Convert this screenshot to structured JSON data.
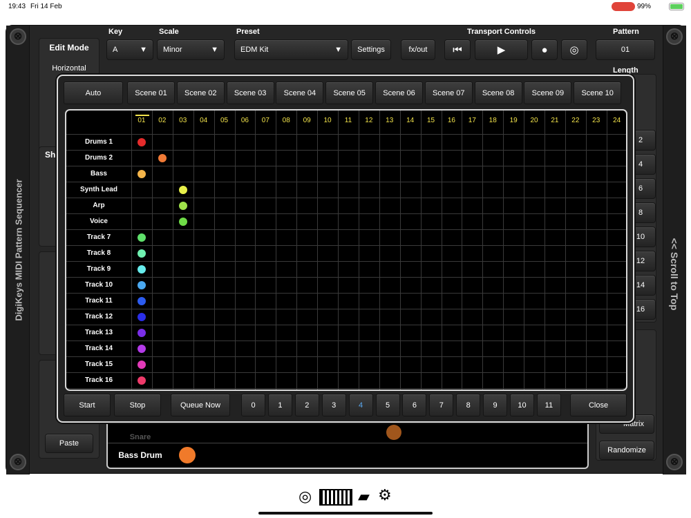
{
  "status": {
    "time": "19:43",
    "date": "Fri 14 Feb",
    "battery": "99%"
  },
  "app": {
    "title": "DigiKeys MIDI Pattern Sequencer",
    "scroll_to_top": "<< Scroll to Top"
  },
  "top": {
    "key_label": "Key",
    "key_value": "A",
    "scale_label": "Scale",
    "scale_value": "Minor",
    "preset_label": "Preset",
    "preset_value": "EDM Kit",
    "settings": "Settings",
    "fxout": "fx/out",
    "transport_label": "Transport Controls",
    "pattern_label": "Pattern",
    "pattern_value": "01",
    "length_label": "Length"
  },
  "left_panel": {
    "edit_mode_label": "Edit Mode",
    "edit_mode_value": "Horizontal",
    "paste": "Paste",
    "sho": "Sho"
  },
  "right_panel": {
    "numbers": [
      "2",
      "4",
      "6",
      "8",
      "10",
      "12",
      "14",
      "16"
    ],
    "matrix": "Matrix",
    "randomize": "Randomize"
  },
  "background_rows": {
    "snare": "Snare",
    "bass_drum": "Bass Drum"
  },
  "modal": {
    "auto": "Auto",
    "scenes": [
      "Scene 01",
      "Scene 02",
      "Scene 03",
      "Scene 04",
      "Scene 05",
      "Scene 06",
      "Scene 07",
      "Scene 08",
      "Scene 09",
      "Scene 10"
    ],
    "columns": [
      "01",
      "02",
      "03",
      "04",
      "05",
      "06",
      "07",
      "08",
      "09",
      "10",
      "11",
      "12",
      "13",
      "14",
      "15",
      "16",
      "17",
      "18",
      "19",
      "20",
      "21",
      "22",
      "23",
      "24"
    ],
    "tracks": [
      {
        "name": "Drums 1",
        "dot_col": 0,
        "color": "#e52b2b"
      },
      {
        "name": "Drums 2",
        "dot_col": 1,
        "color": "#f07a36"
      },
      {
        "name": "Bass",
        "dot_col": 0,
        "color": "#f4b54a"
      },
      {
        "name": "Synth Lead",
        "dot_col": 2,
        "color": "#e8f04a"
      },
      {
        "name": "Arp",
        "dot_col": 2,
        "color": "#9fe24a"
      },
      {
        "name": "Voice",
        "dot_col": 2,
        "color": "#6fdc47"
      },
      {
        "name": "Track 7",
        "dot_col": 0,
        "color": "#5fe06b"
      },
      {
        "name": "Track 8",
        "dot_col": 0,
        "color": "#6ff0b0"
      },
      {
        "name": "Track 9",
        "dot_col": 0,
        "color": "#67ecec"
      },
      {
        "name": "Track 10",
        "dot_col": 0,
        "color": "#4aa8f0"
      },
      {
        "name": "Track 11",
        "dot_col": 0,
        "color": "#2c5cf0"
      },
      {
        "name": "Track 12",
        "dot_col": 0,
        "color": "#2a2ee8"
      },
      {
        "name": "Track 13",
        "dot_col": 0,
        "color": "#7a2ee8"
      },
      {
        "name": "Track 14",
        "dot_col": 0,
        "color": "#b43ae8"
      },
      {
        "name": "Track 15",
        "dot_col": 0,
        "color": "#e23ab8"
      },
      {
        "name": "Track 16",
        "dot_col": 0,
        "color": "#ee3a6a"
      }
    ],
    "start": "Start",
    "stop": "Stop",
    "queue_now": "Queue Now",
    "queue_numbers": [
      "0",
      "1",
      "2",
      "3",
      "4",
      "5",
      "6",
      "7",
      "8",
      "9",
      "10",
      "11"
    ],
    "queue_selected": "4",
    "close": "Close"
  },
  "colors": {
    "accent_yellow": "#f3e44b",
    "selected_blue": "#5aa8f0"
  }
}
